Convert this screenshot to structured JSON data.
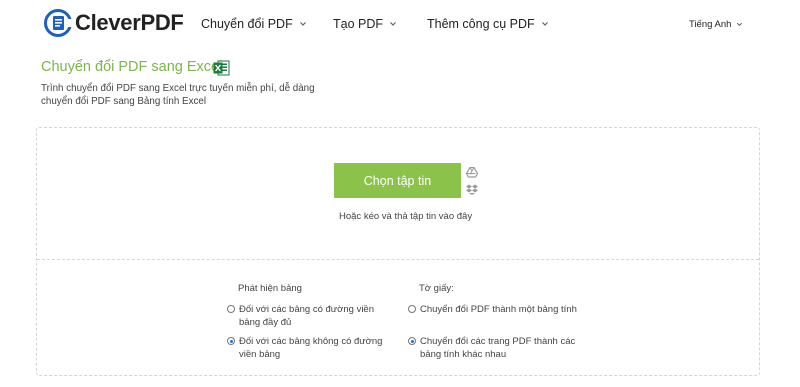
{
  "header": {
    "logo_text": "CleverPDF",
    "nav": [
      {
        "label": "Chuyển đổi PDF"
      },
      {
        "label": "Tạo PDF"
      },
      {
        "label": "Thêm công cụ PDF"
      }
    ],
    "language": "Tiếng Anh"
  },
  "page": {
    "title": "Chuyển đổi PDF sang Excel",
    "subtitle": "Trình chuyển đổi PDF sang Excel trực tuyến miễn phí, dễ dàng chuyển đổi PDF sang Bảng tính Excel"
  },
  "upload": {
    "choose_button": "Chọn tập tin",
    "drop_hint": "Hoặc kéo và thả tập tin vào đây"
  },
  "options": {
    "table_detection": {
      "heading": "Phát hiện bảng",
      "choices": [
        {
          "label": "Đối với các bảng có đường viền bảng đầy đủ",
          "checked": false
        },
        {
          "label": "Đối với các bảng không có đường viền bảng",
          "checked": true
        }
      ]
    },
    "sheet": {
      "heading": "Tờ giấy:",
      "choices": [
        {
          "label": "Chuyển đổi PDF thành một bảng tính",
          "checked": false
        },
        {
          "label": "Chuyển đổi các trang PDF thành các bảng tính khác nhau",
          "checked": true
        }
      ]
    }
  },
  "colors": {
    "accent_green": "#8bc34a",
    "title_green": "#7ab648",
    "logo_blue": "#1f5fbf",
    "excel_green": "#1d7a3e"
  },
  "icons": [
    "logo-icon",
    "chevron-down-icon",
    "excel-icon",
    "google-drive-icon",
    "dropbox-icon"
  ]
}
